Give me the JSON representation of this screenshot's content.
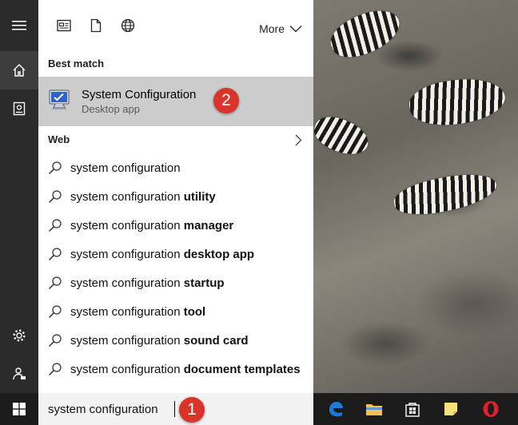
{
  "rail": {
    "items": [
      {
        "name": "hamburger-menu",
        "icon": "hamburger-icon"
      },
      {
        "name": "home",
        "icon": "home-icon",
        "active": true
      },
      {
        "name": "notebook",
        "icon": "notebook-icon"
      }
    ],
    "bottom": [
      {
        "name": "settings",
        "icon": "gear-icon"
      },
      {
        "name": "feedback",
        "icon": "feedback-icon"
      }
    ]
  },
  "panel": {
    "filters": [
      {
        "name": "apps",
        "icon": "apps-filter-icon"
      },
      {
        "name": "documents",
        "icon": "document-icon"
      },
      {
        "name": "web",
        "icon": "globe-icon"
      }
    ],
    "more_label": "More",
    "best_match_heading": "Best match",
    "best_match": {
      "title": "System Configuration",
      "subtitle": "Desktop app",
      "icon": "msconfig-icon"
    },
    "web_heading": "Web",
    "suggestions": [
      {
        "prefix": "system configuration",
        "bold": ""
      },
      {
        "prefix": "system configuration ",
        "bold": "utility"
      },
      {
        "prefix": "system configuration ",
        "bold": "manager"
      },
      {
        "prefix": "system configuration ",
        "bold": "desktop app"
      },
      {
        "prefix": "system configuration ",
        "bold": "startup"
      },
      {
        "prefix": "system configuration ",
        "bold": "tool"
      },
      {
        "prefix": "system configuration ",
        "bold": "sound card"
      },
      {
        "prefix": "system configuration ",
        "bold": "document templates"
      }
    ]
  },
  "callouts": {
    "first": "1",
    "second": "2"
  },
  "taskbar": {
    "search_value": "system configuration",
    "pinned": [
      {
        "name": "edge",
        "icon": "edge-icon",
        "color": "#1e7ad6"
      },
      {
        "name": "file-explorer",
        "icon": "folder-icon",
        "color": "#f2c14e"
      },
      {
        "name": "store",
        "icon": "store-icon",
        "color": "#ffffff"
      },
      {
        "name": "sticky-notes",
        "icon": "sticky-note-icon",
        "color": "#f5e27a"
      },
      {
        "name": "opera",
        "icon": "opera-icon",
        "color": "#e0202c"
      }
    ]
  },
  "colors": {
    "rail_bg": "#2b2b2b",
    "selected_bg": "#cccccc",
    "taskbar_bg": "#1c1c1c",
    "badge": "#d9342a"
  }
}
